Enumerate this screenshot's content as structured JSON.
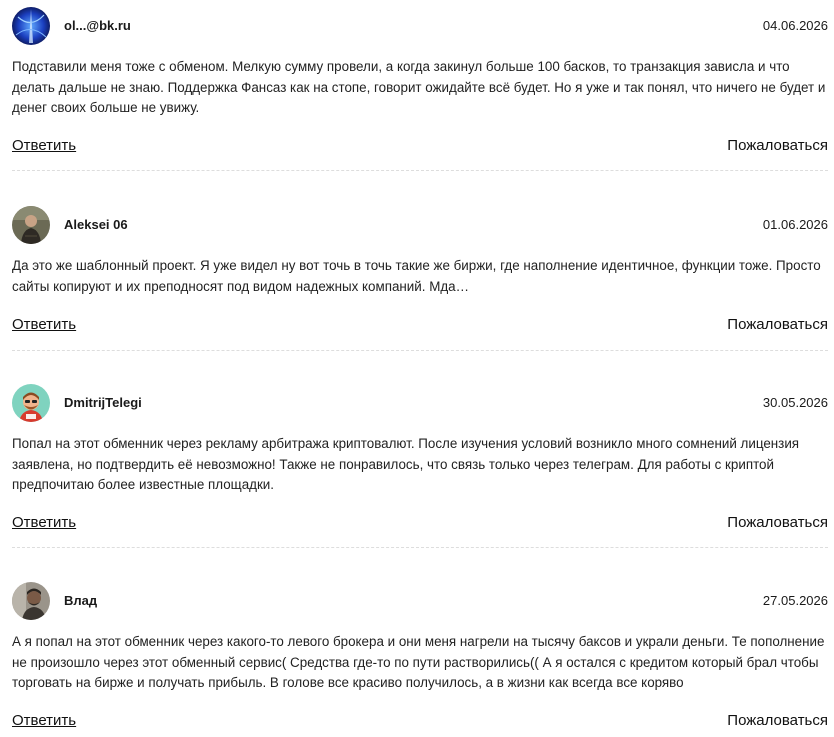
{
  "comments": [
    {
      "author": "ol...@bk.ru",
      "date": "04.06.2026",
      "avatar_icon": "blue-abstract-avatar",
      "text": "Подставили меня тоже с обменом. Мелкую сумму провели, а когда закинул больше 100 басков, то транзакция зависла и что делать дальше не знаю. Поддержка Фансаз как на стопе, говорит ожидайте всё будет. Но я уже и так понял, что ничего не будет и денег своих больше не увижу.",
      "reply_label": "Ответить",
      "report_label": "Пожаловаться"
    },
    {
      "author": "Aleksei 06",
      "date": "01.06.2026",
      "avatar_icon": "man-photo-avatar",
      "text": "Да это же шаблонный проект. Я уже видел ну вот точь в точь такие же биржи, где наполнение идентичное, функции тоже. Просто сайты копируют и их преподносят под видом надежных компаний. Мда…",
      "reply_label": "Ответить",
      "report_label": "Пожаловаться"
    },
    {
      "author": "DmitrijTelegi",
      "date": "30.05.2026",
      "avatar_icon": "cartoon-man-avatar",
      "text": "Попал на этот обменник через рекламу арбитража криптовалют. После изучения условий возникло много сомнений лицензия заявлена, но подтвердить её невозможно! Также не понравилось, что связь только через телеграм. Для работы с криптой предпочитаю более известные площадки.",
      "reply_label": "Ответить",
      "report_label": "Пожаловаться"
    },
    {
      "author": "Влад",
      "date": "27.05.2026",
      "avatar_icon": "man-portrait-avatar",
      "text": "А я попал на этот обменник через какого-то левого брокера и они меня нагрели на тысячу баксов и украли деньги. Те пополнение не произошло через этот обменный сервис( Средства где-то по пути растворились(( А я остался с кредитом который брал чтобы торговать на бирже и получать прибыль. В голове все красиво получилось, а в жизни как всегда все коряво",
      "reply_label": "Ответить",
      "report_label": "Пожаловаться"
    }
  ]
}
